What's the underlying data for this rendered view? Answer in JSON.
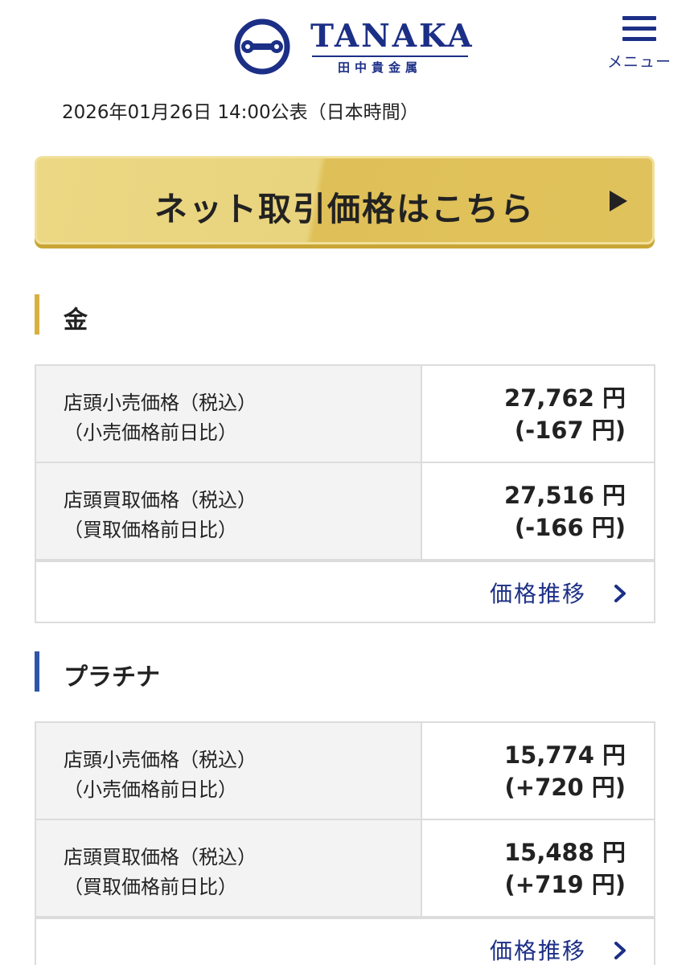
{
  "header": {
    "logo_name": "TANAKA",
    "logo_sub": "田中貴金属",
    "menu_label": "メニュー"
  },
  "timestamp": "2026年01月26日 14:00公表（日本時間）",
  "cta": {
    "label": "ネット取引価格はこちら"
  },
  "colors": {
    "brand_navy": "#1c2f86",
    "gold_accent": "#d9b03f",
    "platinum_accent": "#2f55a8"
  },
  "sections": [
    {
      "title": "金",
      "rows": [
        {
          "label_line1": "店頭小売価格（税込）",
          "label_line2": "（小売価格前日比）",
          "price": "27,762 円",
          "change": "(-167 円)"
        },
        {
          "label_line1": "店頭買取価格（税込）",
          "label_line2": "（買取価格前日比）",
          "price": "27,516 円",
          "change": "(-166 円)"
        }
      ],
      "history_label": "価格推移"
    },
    {
      "title": "プラチナ",
      "rows": [
        {
          "label_line1": "店頭小売価格（税込）",
          "label_line2": "（小売価格前日比）",
          "price": "15,774 円",
          "change": "(+720 円)"
        },
        {
          "label_line1": "店頭買取価格（税込）",
          "label_line2": "（買取価格前日比）",
          "price": "15,488 円",
          "change": "(+719 円)"
        }
      ],
      "history_label": "価格推移"
    }
  ]
}
